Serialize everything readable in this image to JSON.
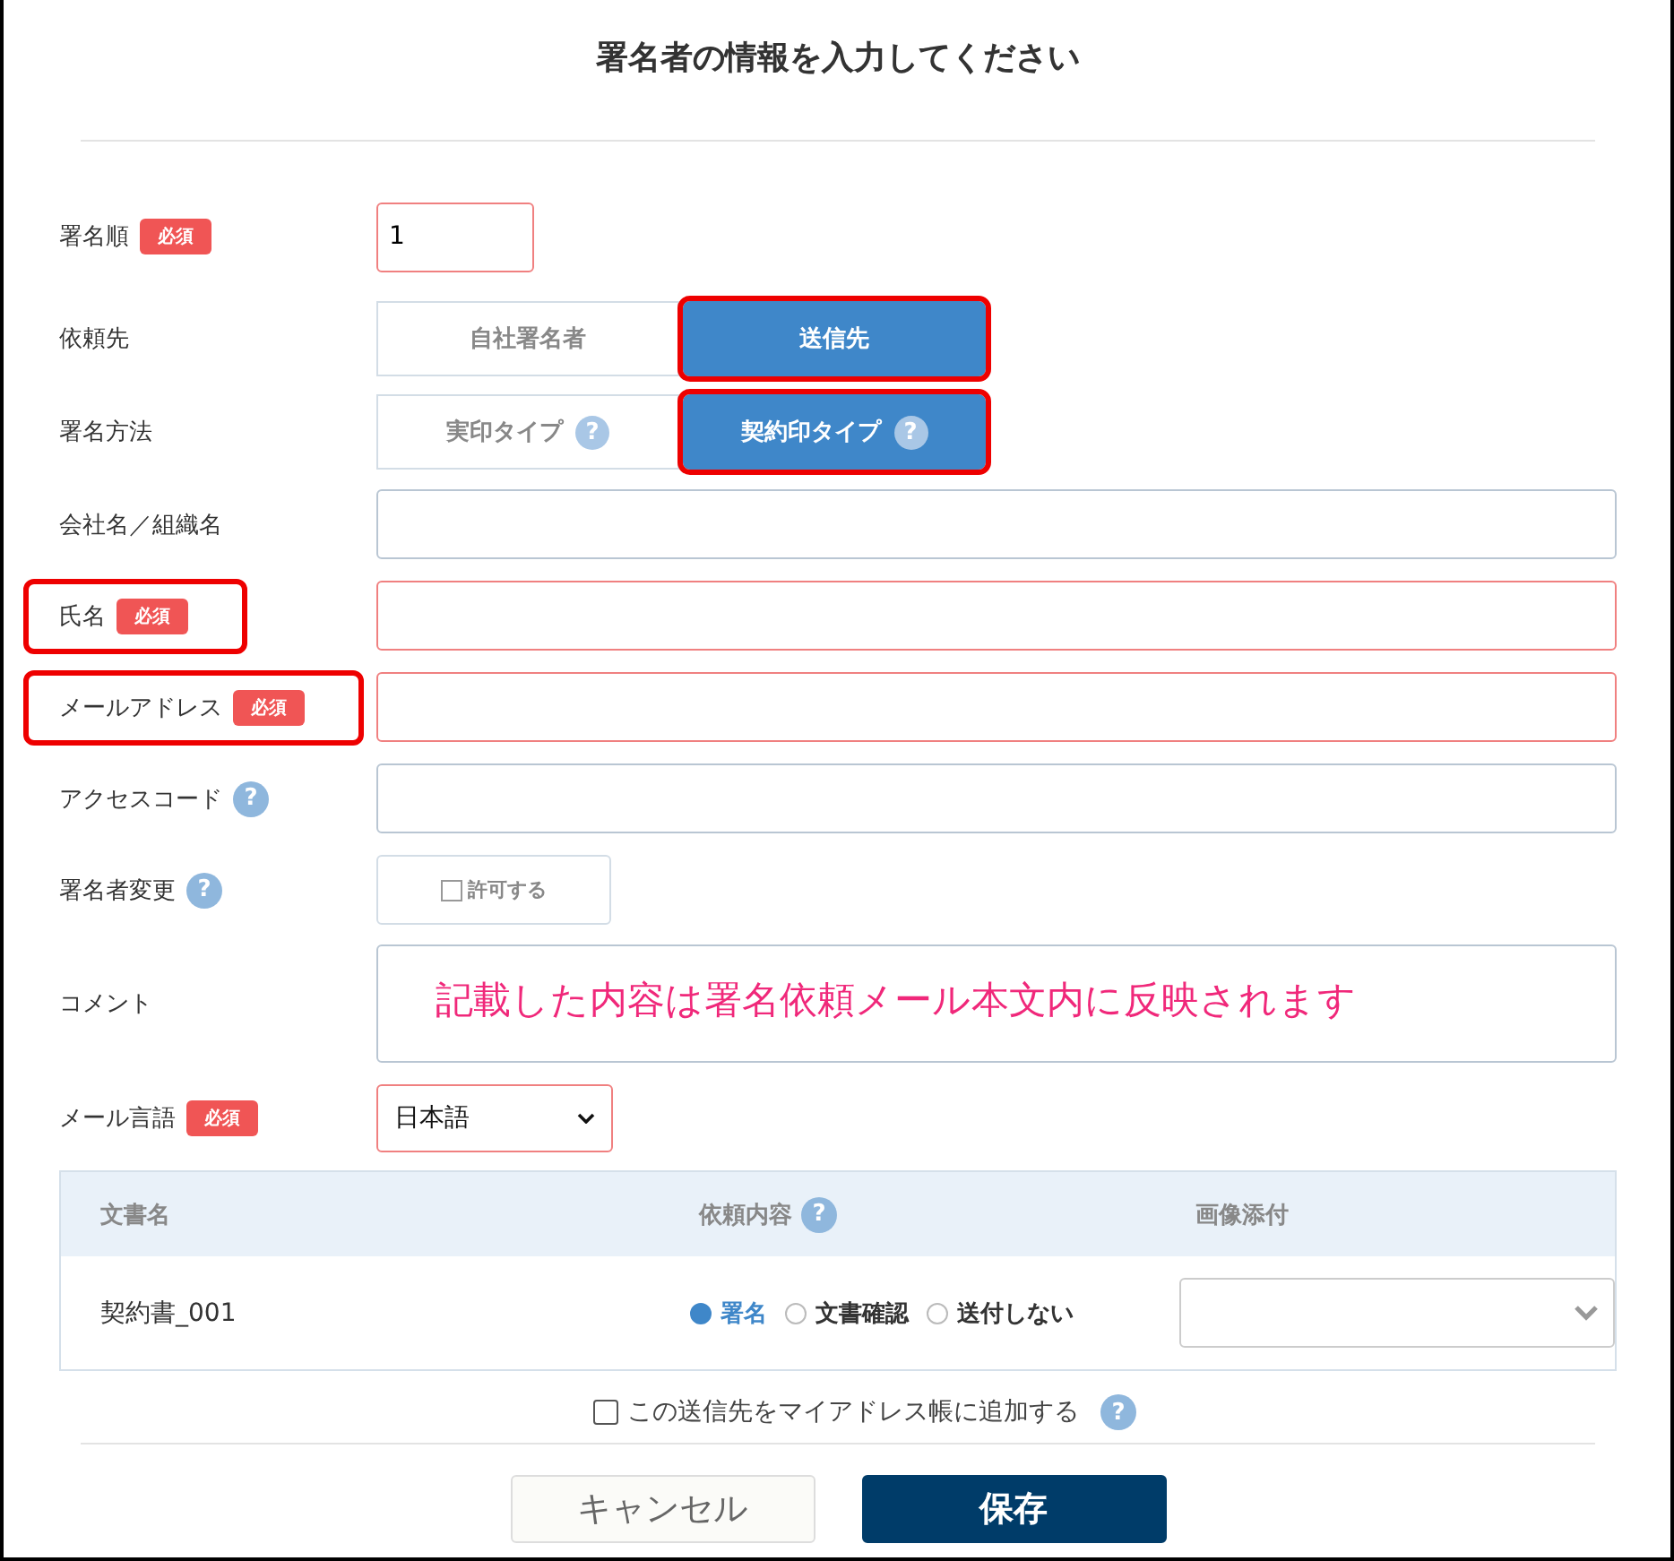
{
  "title": "署名者の情報を入力してください",
  "fields": [
    {
      "kind": "number",
      "label": "署名順",
      "badge": "必須",
      "value": "1",
      "highlighted": false
    },
    {
      "kind": "toggle",
      "label": "依頼先",
      "highlighted": false,
      "options": [
        {
          "label": "自社署名者",
          "selected": false,
          "highlighted": false
        },
        {
          "label": "送信先",
          "selected": true,
          "highlighted": true
        }
      ]
    },
    {
      "kind": "toggle",
      "label": "署名方法",
      "highlighted": false,
      "options": [
        {
          "label": "実印タイプ",
          "help": "?",
          "selected": false,
          "highlighted": false
        },
        {
          "label": "契約印タイプ",
          "help": "?",
          "selected": true,
          "highlighted": true
        }
      ]
    },
    {
      "kind": "text",
      "label": "会社名／組織名",
      "highlighted": false
    },
    {
      "kind": "text",
      "label": "氏名",
      "badge": "必須",
      "highlighted": true
    },
    {
      "kind": "text",
      "label": "メールアドレス",
      "badge": "必須",
      "highlighted": true
    },
    {
      "kind": "text",
      "label": "アクセスコード",
      "help": "?",
      "highlighted": false
    },
    {
      "kind": "checkbox",
      "label": "署名者変更",
      "help": "?",
      "option": "許可する",
      "checked": false,
      "highlighted": false
    },
    {
      "kind": "textarea",
      "label": "コメント",
      "value": "記載した内容は署名依頼メール本文内に反映されます",
      "highlighted": false
    },
    {
      "kind": "select",
      "label": "メール言語",
      "badge": "必須",
      "value": "日本語",
      "highlighted": false
    }
  ],
  "table": {
    "columns": [
      {
        "label": "文書名"
      },
      {
        "label": "依頼内容",
        "help": "?"
      },
      {
        "label": "画像添付"
      }
    ],
    "rows": [
      {
        "name": "契約書_001",
        "options": [
          {
            "label": "署名",
            "selected": true
          },
          {
            "label": "文書確認",
            "selected": false
          },
          {
            "label": "送付しない",
            "selected": false
          }
        ]
      }
    ]
  },
  "address_book": {
    "label": "この送信先をマイアドレス帳に追加する",
    "checked": false,
    "help": "?"
  },
  "buttons": [
    {
      "label": "キャンセル",
      "kind": "secondary"
    },
    {
      "label": "保存",
      "kind": "primary"
    }
  ]
}
